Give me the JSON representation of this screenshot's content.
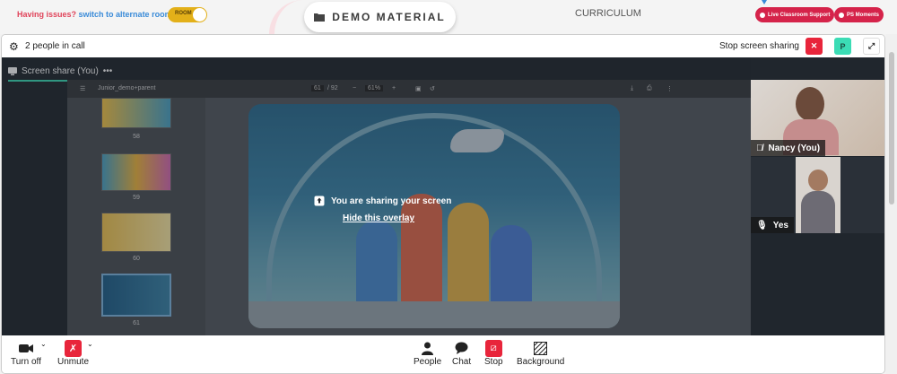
{
  "topbar": {
    "issue_text": "Having issues?",
    "issue_link": "switch to alternate room",
    "room_toggle": "ROOM",
    "demo_button": "DEMO MATERIAL",
    "curriculum": "CURRICULUM",
    "live_support": "Live Classroom Support",
    "ps_moments": "PS Moments"
  },
  "callbar": {
    "people_count": "2 people in call",
    "stop_sharing": "Stop screen sharing",
    "avatar_letter": "P"
  },
  "screen_share": {
    "tab_label": "Screen share (You)",
    "tab_menu": "•••",
    "overlay_message": "You are sharing your screen",
    "overlay_hide": "Hide this overlay"
  },
  "pdf": {
    "file_name": "Junior_demo+parent",
    "page_current": "61",
    "page_total": "/ 92",
    "zoom": "61%",
    "thumb_numbers": [
      "58",
      "59",
      "60",
      "61"
    ]
  },
  "participants": [
    {
      "name": "Nancy (You)"
    },
    {
      "name": "Yes"
    }
  ],
  "controls": {
    "turn_off": "Turn off",
    "unmute": "Unmute",
    "people": "People",
    "chat": "Chat",
    "stop": "Stop",
    "background": "Background"
  },
  "colors": {
    "accent_green": "#3bdcb5",
    "danger_red": "#d5234a",
    "toggle_gold": "#e3b019"
  }
}
